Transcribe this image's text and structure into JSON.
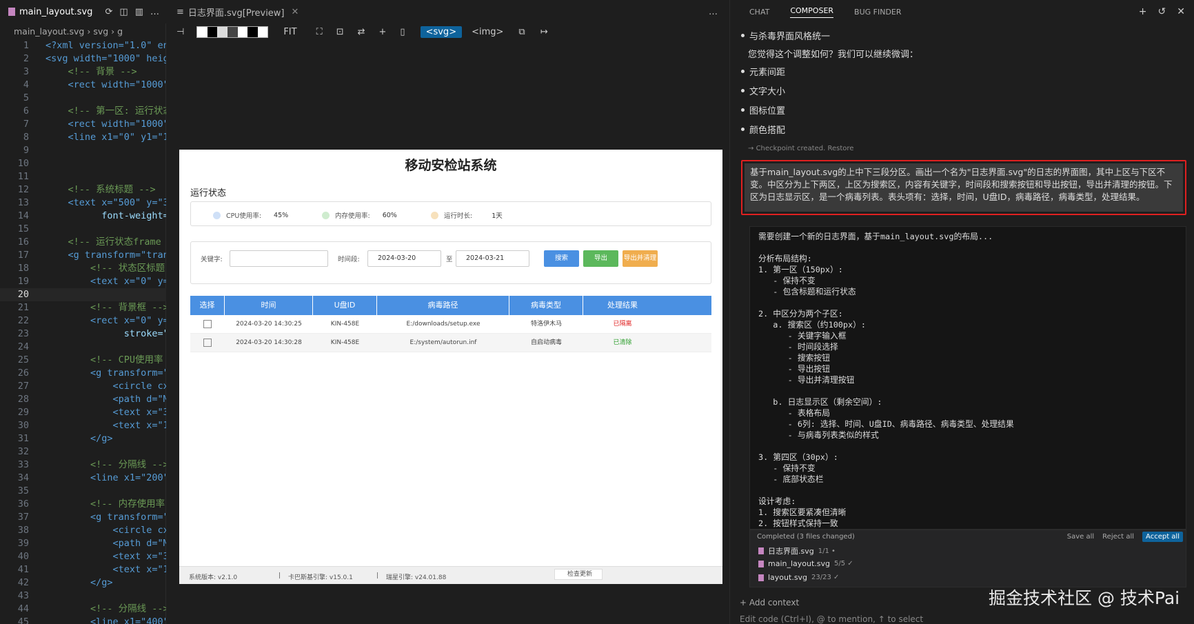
{
  "left": {
    "tab_label": "main_layout.svg",
    "breadcrumb": [
      "main_layout.svg",
      "svg",
      "g"
    ],
    "lines": [
      {
        "n": "1",
        "t": "<?xml version=\"1.0\" enc",
        "k": "tg"
      },
      {
        "n": "2",
        "t": "<svg width=\"1000\" heigh",
        "k": "tg"
      },
      {
        "n": "3",
        "t": "    <!-- 背景 -->",
        "k": "cm"
      },
      {
        "n": "4",
        "t": "    <rect width=\"1000\"",
        "k": "tg"
      },
      {
        "n": "5",
        "t": "",
        "k": ""
      },
      {
        "n": "6",
        "t": "    <!-- 第一区: 运行状态",
        "k": "cm"
      },
      {
        "n": "7",
        "t": "    <rect width=\"1000\"",
        "k": "tg"
      },
      {
        "n": "8",
        "t": "    <line x1=\"0\" y1=\"15",
        "k": "tg"
      },
      {
        "n": "9",
        "t": "",
        "k": ""
      },
      {
        "n": "10",
        "t": "",
        "k": ""
      },
      {
        "n": "11",
        "t": "",
        "k": ""
      },
      {
        "n": "12",
        "t": "    <!-- 系统标题 -->",
        "k": "cm"
      },
      {
        "n": "13",
        "t": "    <text x=\"500\" y=\"35",
        "k": "tg"
      },
      {
        "n": "14",
        "t": "          font-weight=\"",
        "k": ""
      },
      {
        "n": "15",
        "t": "",
        "k": ""
      },
      {
        "n": "16",
        "t": "    <!-- 运行状态frame",
        "k": "cm"
      },
      {
        "n": "17",
        "t": "    <g transform=\"trans",
        "k": "tg"
      },
      {
        "n": "18",
        "t": "        <!-- 状态区标题",
        "k": "cm"
      },
      {
        "n": "19",
        "t": "        <text x=\"0\" y=\"",
        "k": "tg"
      },
      {
        "n": "20",
        "t": "",
        "k": "cur"
      },
      {
        "n": "21",
        "t": "        <!-- 背景框 -->",
        "k": "cm"
      },
      {
        "n": "22",
        "t": "        <rect x=\"0\" y=\"",
        "k": "tg"
      },
      {
        "n": "23",
        "t": "              stroke=\"",
        "k": ""
      },
      {
        "n": "24",
        "t": "",
        "k": ""
      },
      {
        "n": "25",
        "t": "        <!-- CPU使用率",
        "k": "cm"
      },
      {
        "n": "26",
        "t": "        <g transform=\"t",
        "k": "tg"
      },
      {
        "n": "27",
        "t": "            <circle cx=",
        "k": "tg"
      },
      {
        "n": "28",
        "t": "            <path d=\"M1",
        "k": "tg"
      },
      {
        "n": "29",
        "t": "            <text x=\"30",
        "k": "tg"
      },
      {
        "n": "30",
        "t": "            <text x=\"12",
        "k": "tg"
      },
      {
        "n": "31",
        "t": "        </g>",
        "k": "tg"
      },
      {
        "n": "32",
        "t": "",
        "k": ""
      },
      {
        "n": "33",
        "t": "        <!-- 分隔线 -->",
        "k": "cm"
      },
      {
        "n": "34",
        "t": "        <line x1=\"200\"",
        "k": "tg"
      },
      {
        "n": "35",
        "t": "",
        "k": ""
      },
      {
        "n": "36",
        "t": "        <!-- 内存使用率",
        "k": "cm"
      },
      {
        "n": "37",
        "t": "        <g transform=\"t",
        "k": "tg"
      },
      {
        "n": "38",
        "t": "            <circle cx=",
        "k": "tg"
      },
      {
        "n": "39",
        "t": "            <path d=\"M6",
        "k": "tg"
      },
      {
        "n": "40",
        "t": "            <text x=\"30",
        "k": "tg"
      },
      {
        "n": "41",
        "t": "            <text x=\"12",
        "k": "tg"
      },
      {
        "n": "42",
        "t": "        </g>",
        "k": "tg"
      },
      {
        "n": "43",
        "t": "",
        "k": ""
      },
      {
        "n": "44",
        "t": "        <!-- 分隔线 -->",
        "k": "cm"
      },
      {
        "n": "45",
        "t": "        <line x1=\"400\"",
        "k": "tg"
      }
    ]
  },
  "middle": {
    "tab_label": "日志界面.svg[Preview]",
    "toolbar": {
      "fit": "FIT",
      "svg": "<svg>",
      "img": "<img>"
    },
    "preview": {
      "title": "移动安检站系统",
      "section": "运行状态",
      "stats": [
        {
          "label": "CPU使用率:",
          "value": "45%"
        },
        {
          "label": "内存使用率:",
          "value": "60%"
        },
        {
          "label": "运行时长:",
          "value": "1天"
        }
      ],
      "search": {
        "keyword_label": "关键字:",
        "time_label": "时间段:",
        "date_from": "2024-03-20",
        "to": "至",
        "date_to": "2024-03-21",
        "btn_search": "搜索",
        "btn_export": "导出",
        "btn_export_clean": "导出并清理"
      },
      "table": {
        "headers": [
          "选择",
          "时间",
          "U盘ID",
          "病毒路径",
          "病毒类型",
          "处理结果"
        ],
        "rows": [
          {
            "time": "2024-03-20 14:30:25",
            "id": "KIN-458E",
            "path": "E:/downloads/setup.exe",
            "type": "特洛伊木马",
            "result": "已隔离"
          },
          {
            "time": "2024-03-20 14:30:28",
            "id": "KIN-458E",
            "path": "E:/system/autorun.inf",
            "type": "自启动病毒",
            "result": "已清除"
          }
        ]
      },
      "footer": {
        "version": "系统版本: v2.1.0",
        "engine": "卡巴斯基引擎: v15.0.1",
        "rising": "瑞星引擎: v24.01.88",
        "update": "检查更新"
      }
    }
  },
  "right": {
    "tabs": [
      "CHAT",
      "COMPOSER",
      "BUG FINDER"
    ],
    "top_bullet": "与杀毒界面风格统一",
    "ask": "您觉得这个调整如何？我们可以继续微调：",
    "bullets": [
      "元素间距",
      "文字大小",
      "图标位置",
      "颜色搭配"
    ],
    "checkpoint": "Checkpoint created.",
    "restore": "Restore",
    "user_prompt": "基于main_layout.svg的上中下三段分区。画出一个名为\"日志界面.svg\"的日志的界面图，其中上区与下区不变。中区分为上下两区，上区为搜索区，内容有关键字，时间段和搜索按钮和导出按钮，导出并清理的按钮。下区为日志显示区，是一个病毒列表。表头项有：选择，时间，U盘ID，病毒路径，病毒类型，处理结果。",
    "response_lines": [
      "需要创建一个新的日志界面，基于main_layout.svg的布局...",
      "",
      "分析布局结构:",
      "1. 第一区（150px）:",
      "   - 保持不变",
      "   - 包含标题和运行状态",
      "",
      "2. 中区分为两个子区:",
      "   a. 搜索区（约100px）:",
      "      - 关键字输入框",
      "      - 时间段选择",
      "      - 搜索按钮",
      "      - 导出按钮",
      "      - 导出并清理按钮",
      "",
      "   b. 日志显示区（剩余空间）:",
      "      - 表格布局",
      "      - 6列: 选择、时间、U盘ID、病毒路径、病毒类型、处理结果",
      "      - 与病毒列表类似的样式",
      "",
      "3. 第四区（30px）:",
      "   - 保持不变",
      "   - 底部状态栏",
      "",
      "设计考虑:",
      "1. 搜索区要紧凑但清晰",
      "2. 按钮样式保持一致"
    ],
    "completed": {
      "header": "Completed (3 files changed)",
      "save_all": "Save all",
      "reject_all": "Reject all",
      "accept_all": "Accept all",
      "files": [
        {
          "name": "日志界面.svg",
          "count": "1/1 •"
        },
        {
          "name": "main_layout.svg",
          "count": "5/5 ✓"
        },
        {
          "name": "layout.svg",
          "count": "23/23 ✓"
        }
      ]
    },
    "add_context": "+ Add context",
    "edit_hint": "Edit code (Ctrl+I), @ to mention, ↑ to select"
  },
  "watermark": "掘金技术社区 @ 技术Pai",
  "colors": {
    "accent": "#0e639c",
    "table_header": "#4a90e2",
    "btn_search": "#4a90e2",
    "btn_export": "#5cb85c",
    "btn_clean": "#f0ad4e",
    "highlight_border": "#e02020"
  }
}
